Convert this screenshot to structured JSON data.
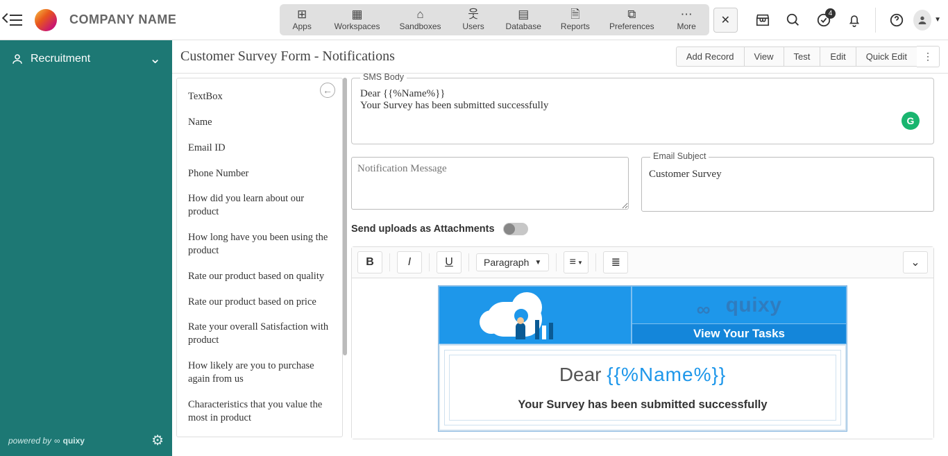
{
  "brand": "COMPANY NAME",
  "nav": {
    "items": [
      {
        "icon": "⊞",
        "label": "Apps"
      },
      {
        "icon": "▦",
        "label": "Workspaces"
      },
      {
        "icon": "⌂",
        "label": "Sandboxes"
      },
      {
        "icon": "웃",
        "label": "Users"
      },
      {
        "icon": "▤",
        "label": "Database"
      },
      {
        "icon": "🗎",
        "label": "Reports"
      },
      {
        "icon": "⧉",
        "label": "Preferences"
      },
      {
        "icon": "⋯",
        "label": "More"
      }
    ],
    "close": "✕",
    "badge": "4"
  },
  "sidebar": {
    "title": "Recruitment",
    "poweredBy": "powered by",
    "brand": "quixy"
  },
  "page": {
    "title": "Customer Survey Form - Notifications",
    "actions": [
      "Add Record",
      "View",
      "Test",
      "Edit",
      "Quick Edit"
    ]
  },
  "fields": [
    "TextBox",
    "Name",
    "Email ID",
    "Phone Number",
    "How did you learn about our product",
    "How long have you been using the product",
    "Rate our product based on quality",
    "Rate our product based on price",
    "Rate your overall Satisfaction with product",
    "How likely are you to purchase again from us",
    "Characteristics that you value the most in product"
  ],
  "form": {
    "smsLegend": "SMS Body",
    "smsBody": "Dear {{%Name%}}\nYour Survey has been submitted successfully",
    "notifPlaceholder": "Notification Message",
    "emailSubjLegend": "Email Subject",
    "emailSubj": "Customer Survey",
    "attachLabel": "Send uploads as Attachments",
    "paragraph": "Paragraph"
  },
  "template": {
    "brand": "quixy",
    "viewTasks": "View Your Tasks",
    "dear": "Dear ",
    "namePlaceholder": "{{%Name%}}",
    "msg": "Your Survey has been submitted successfully"
  }
}
